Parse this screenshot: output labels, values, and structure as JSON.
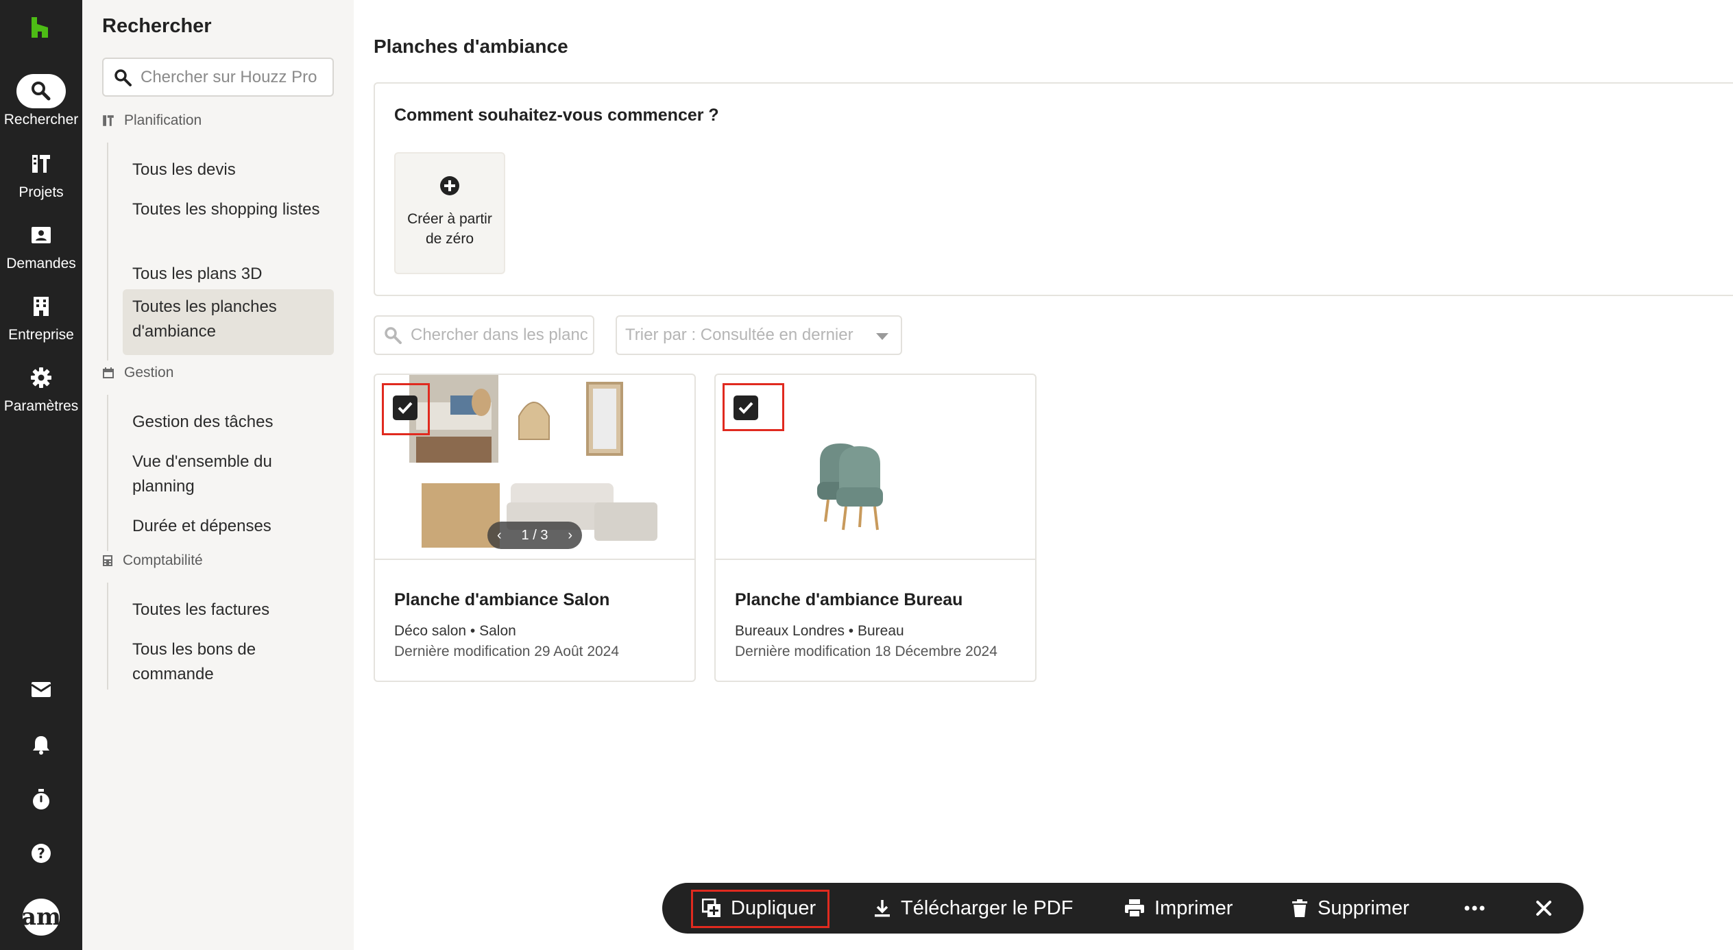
{
  "rail": {
    "items": [
      {
        "label": "Rechercher",
        "icon": "search-icon",
        "active": true
      },
      {
        "label": "Projets",
        "icon": "projects-icon"
      },
      {
        "label": "Demandes",
        "icon": "inbox-contact-icon"
      },
      {
        "label": "Entreprise",
        "icon": "building-icon"
      },
      {
        "label": "Paramètres",
        "icon": "gear-icon"
      }
    ],
    "bottom_icons": [
      "mail-icon",
      "bell-icon",
      "timer-icon",
      "help-icon"
    ],
    "avatar_text": "am",
    "brand_color": "#4dbc15"
  },
  "sidebar": {
    "title": "Rechercher",
    "search_placeholder": "Chercher sur Houzz Pro",
    "sections": [
      {
        "title": "Planification",
        "items": [
          "Tous les devis",
          "Toutes les shopping listes",
          "Tous les plans 3D",
          "Toutes les planches d'ambiance"
        ]
      },
      {
        "title": "Gestion",
        "items": [
          "Gestion des tâches",
          "Vue d'ensemble du planning",
          "Durée et dépenses"
        ]
      },
      {
        "title": "Comptabilité",
        "items": [
          "Toutes les factures",
          "Tous les bons de commande"
        ]
      }
    ],
    "active_item": "Toutes les planches d'ambiance"
  },
  "main": {
    "title": "Planches d'ambiance",
    "start": {
      "question": "Comment souhaitez-vous commencer ?",
      "create_label": "Créer à partir de zéro"
    },
    "search_placeholder": "Chercher dans les planches",
    "sort_label": "Trier par : Consultée en dernier",
    "cards": [
      {
        "title": "Planche d'ambiance Salon",
        "project": "Déco salon",
        "room": "Salon",
        "separator": "•",
        "modified": "Dernière modification 29 Août 2024",
        "pager": "1 / 3",
        "checked": true
      },
      {
        "title": "Planche d'ambiance Bureau",
        "project": "Bureaux Londres",
        "room": "Bureau",
        "separator": "•",
        "modified": "Dernière modification 18 Décembre 2024",
        "checked": true
      }
    ]
  },
  "actionbar": {
    "duplicate": "Dupliquer",
    "download": "Télécharger le PDF",
    "print": "Imprimer",
    "delete": "Supprimer",
    "highlight_color": "#e02a1f"
  }
}
